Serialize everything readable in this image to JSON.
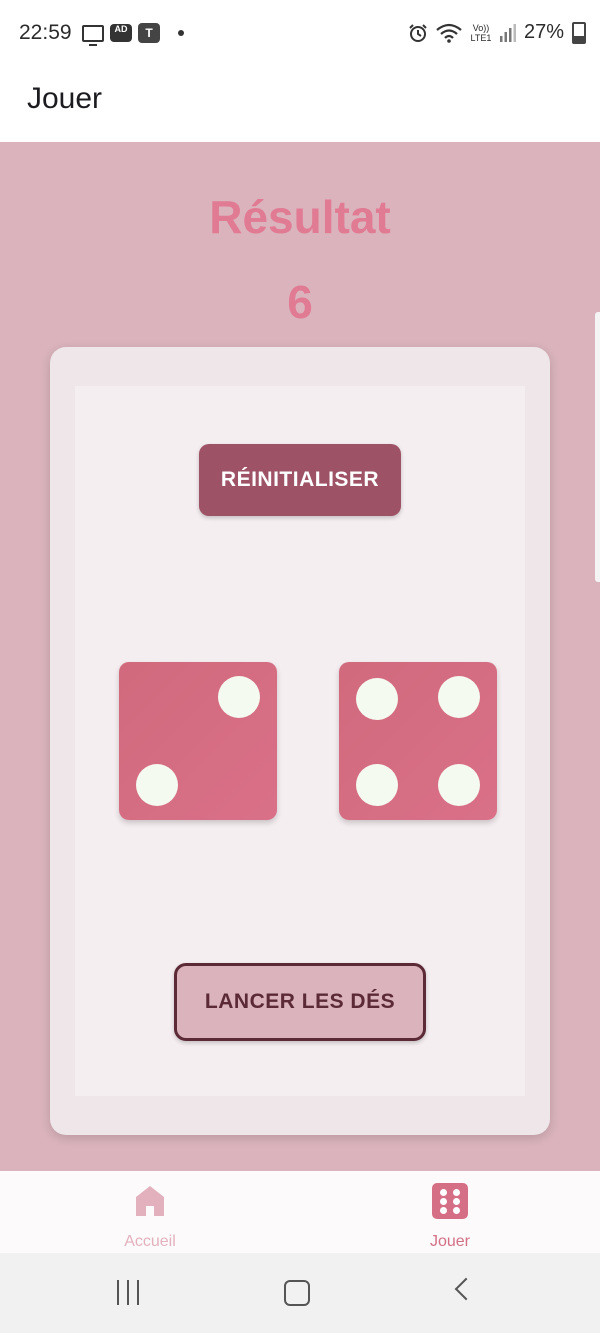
{
  "status_bar": {
    "time": "22:59",
    "left_icons": [
      "monitor-icon",
      "ad-blocker-icon",
      "teams-icon",
      "notification-dot-icon"
    ],
    "ad_badge": "AD",
    "teams_badge": "T",
    "right_icons": [
      "alarm-icon",
      "wifi-icon",
      "volte-icon",
      "signal-icon"
    ],
    "volte_label": "Vo)) LTE1",
    "battery": "27%"
  },
  "app_bar": {
    "title": "Jouer"
  },
  "main": {
    "result_label": "Résultat",
    "result_value": "6",
    "reset_button": "RÉINITIALISER",
    "roll_button": "LANCER LES DÉS",
    "dice_values": [
      2,
      4
    ]
  },
  "bottom_nav": {
    "items": [
      {
        "label": "Accueil",
        "icon": "home-icon"
      },
      {
        "label": "Jouer",
        "icon": "dice-icon"
      }
    ]
  },
  "colors": {
    "background": "#dab3bc",
    "accent": "#e17a93",
    "die": "#d56f86",
    "pip": "#f4faf0",
    "reset_button": "#9e5266",
    "roll_button_border": "#5b2a36"
  }
}
